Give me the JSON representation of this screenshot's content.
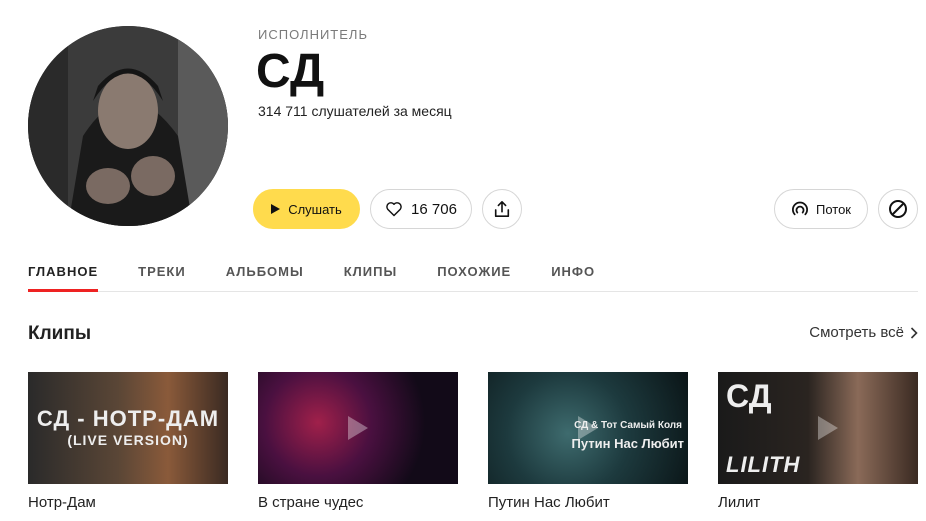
{
  "artist": {
    "kind": "ИСПОЛНИТЕЛЬ",
    "name": "СД",
    "listeners": "314 711 слушателей за месяц"
  },
  "actions": {
    "listen_label": "Слушать",
    "likes_count": "16 706",
    "stream_label": "Поток"
  },
  "icons": {
    "play": "play-icon",
    "like": "heart-icon",
    "share": "share-icon",
    "stream": "stream-icon",
    "block": "block-icon",
    "chevron": "chevron-right-icon"
  },
  "tabs": [
    {
      "label": "ГЛАВНОЕ",
      "active": true
    },
    {
      "label": "ТРЕКИ"
    },
    {
      "label": "АЛЬБОМЫ"
    },
    {
      "label": "КЛИПЫ"
    },
    {
      "label": "ПОХОЖИЕ"
    },
    {
      "label": "ИНФО"
    }
  ],
  "clips_section": {
    "title": "Клипы",
    "see_all": "Смотреть всё"
  },
  "clips": [
    {
      "title": "Нотр-Дам",
      "overlay_line1": "СД - НОТР-ДАМ",
      "overlay_line2": "(LIVE VERSION)"
    },
    {
      "title": "В стране чудес"
    },
    {
      "title": "Путин Нас Любит",
      "overlay_line1": "СД & Тот Самый Коля",
      "overlay_line2": "Путин Нас Любит"
    },
    {
      "title": "Лилит",
      "overlay_line1": "СД",
      "overlay_line2": "LILITH"
    }
  ],
  "colors": {
    "accent_yellow": "#ffdb4d",
    "tab_underline": "#ee2222"
  }
}
